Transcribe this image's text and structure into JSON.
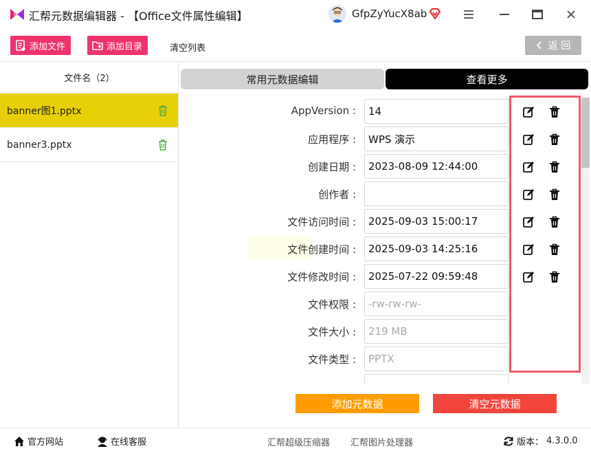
{
  "window": {
    "title": "汇帮元数据编辑器 - 【Office文件属性编辑】",
    "username": "GfpZyYucX8ab"
  },
  "toolbar": {
    "add_file": "添加文件",
    "add_dir": "添加目录",
    "clear_list": "清空列表",
    "back": "返 回"
  },
  "file_list": {
    "header": "文件名（2）",
    "items": [
      {
        "name": "banner图1.pptx",
        "selected": true
      },
      {
        "name": "banner3.pptx",
        "selected": false
      }
    ]
  },
  "tabs": {
    "common": "常用元数据编辑",
    "more": "查看更多"
  },
  "fields": [
    {
      "label": "AppVersion :",
      "value": "14",
      "editable": true
    },
    {
      "label": "应用程序 :",
      "value": "WPS 演示",
      "editable": true
    },
    {
      "label": "创建日期 :",
      "value": "2023-08-09 12:44:00",
      "editable": true
    },
    {
      "label": "创作者 :",
      "value": "",
      "editable": true
    },
    {
      "label": "文件访问时间 :",
      "value": "2025-09-03 15:00:17",
      "editable": true
    },
    {
      "label": "文件创建时间 :",
      "value": "2025-09-03 14:25:16",
      "editable": true
    },
    {
      "label": "文件修改时间 :",
      "value": "2025-07-22 09:59:48",
      "editable": true
    },
    {
      "label": "文件权限 :",
      "value": "-rw-rw-rw-",
      "editable": false
    },
    {
      "label": "文件大小 :",
      "value": "219 MB",
      "editable": false
    },
    {
      "label": "文件类型 :",
      "value": "PPTX",
      "editable": false
    }
  ],
  "actions": {
    "add_meta": "添加元数据",
    "clear_meta": "清空元数据"
  },
  "footer": {
    "website": "官方网站",
    "service": "在线客服",
    "compressor": "汇帮超级压缩器",
    "image_tool": "汇帮图片处理器",
    "version_label": "版本：",
    "version": "4.3.0.0"
  },
  "colors": {
    "brand_pink": "#f0336d",
    "selected_yellow": "#e8d008",
    "highlight_border": "#ee5a67",
    "add_orange": "#ff9d00",
    "clear_red": "#f4453d"
  }
}
